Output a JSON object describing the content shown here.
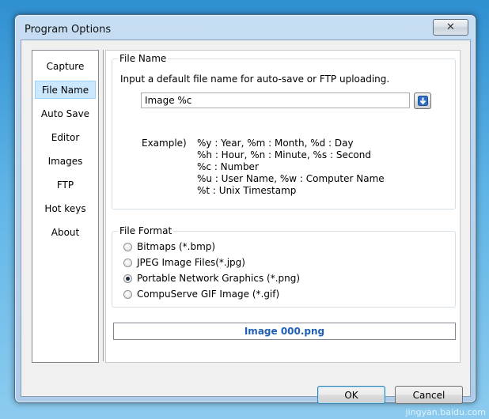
{
  "window": {
    "title": "Program Options",
    "close_icon": "✕"
  },
  "sidebar": {
    "items": [
      {
        "label": "Capture"
      },
      {
        "label": "File Name",
        "selected": true
      },
      {
        "label": "Auto Save"
      },
      {
        "label": "Editor"
      },
      {
        "label": "Images"
      },
      {
        "label": "FTP"
      },
      {
        "label": "Hot keys"
      },
      {
        "label": "About"
      }
    ]
  },
  "file_name": {
    "legend": "File Name",
    "description": "Input a default file name for auto-save or FTP uploading.",
    "input_value": "Image %c",
    "insert_button_icon": "arrow-down-icon",
    "example_label": "Example)",
    "example_lines": [
      "%y : Year, %m : Month, %d : Day",
      "%h : Hour, %n : Minute, %s : Second",
      "%c : Number",
      "%u : User Name, %w : Computer Name",
      "%t : Unix Timestamp"
    ]
  },
  "file_format": {
    "legend": "File Format",
    "options": [
      {
        "label": "Bitmaps (*.bmp)",
        "checked": false
      },
      {
        "label": "JPEG Image Files(*.jpg)",
        "checked": false
      },
      {
        "label": "Portable Network Graphics (*.png)",
        "checked": true
      },
      {
        "label": "CompuServe GIF Image (*.gif)",
        "checked": false
      }
    ]
  },
  "preview": {
    "text": "Image 000.png",
    "color": "#1f5fb5"
  },
  "buttons": {
    "ok": "OK",
    "cancel": "Cancel"
  },
  "watermark": "jingyan.baidu.com"
}
